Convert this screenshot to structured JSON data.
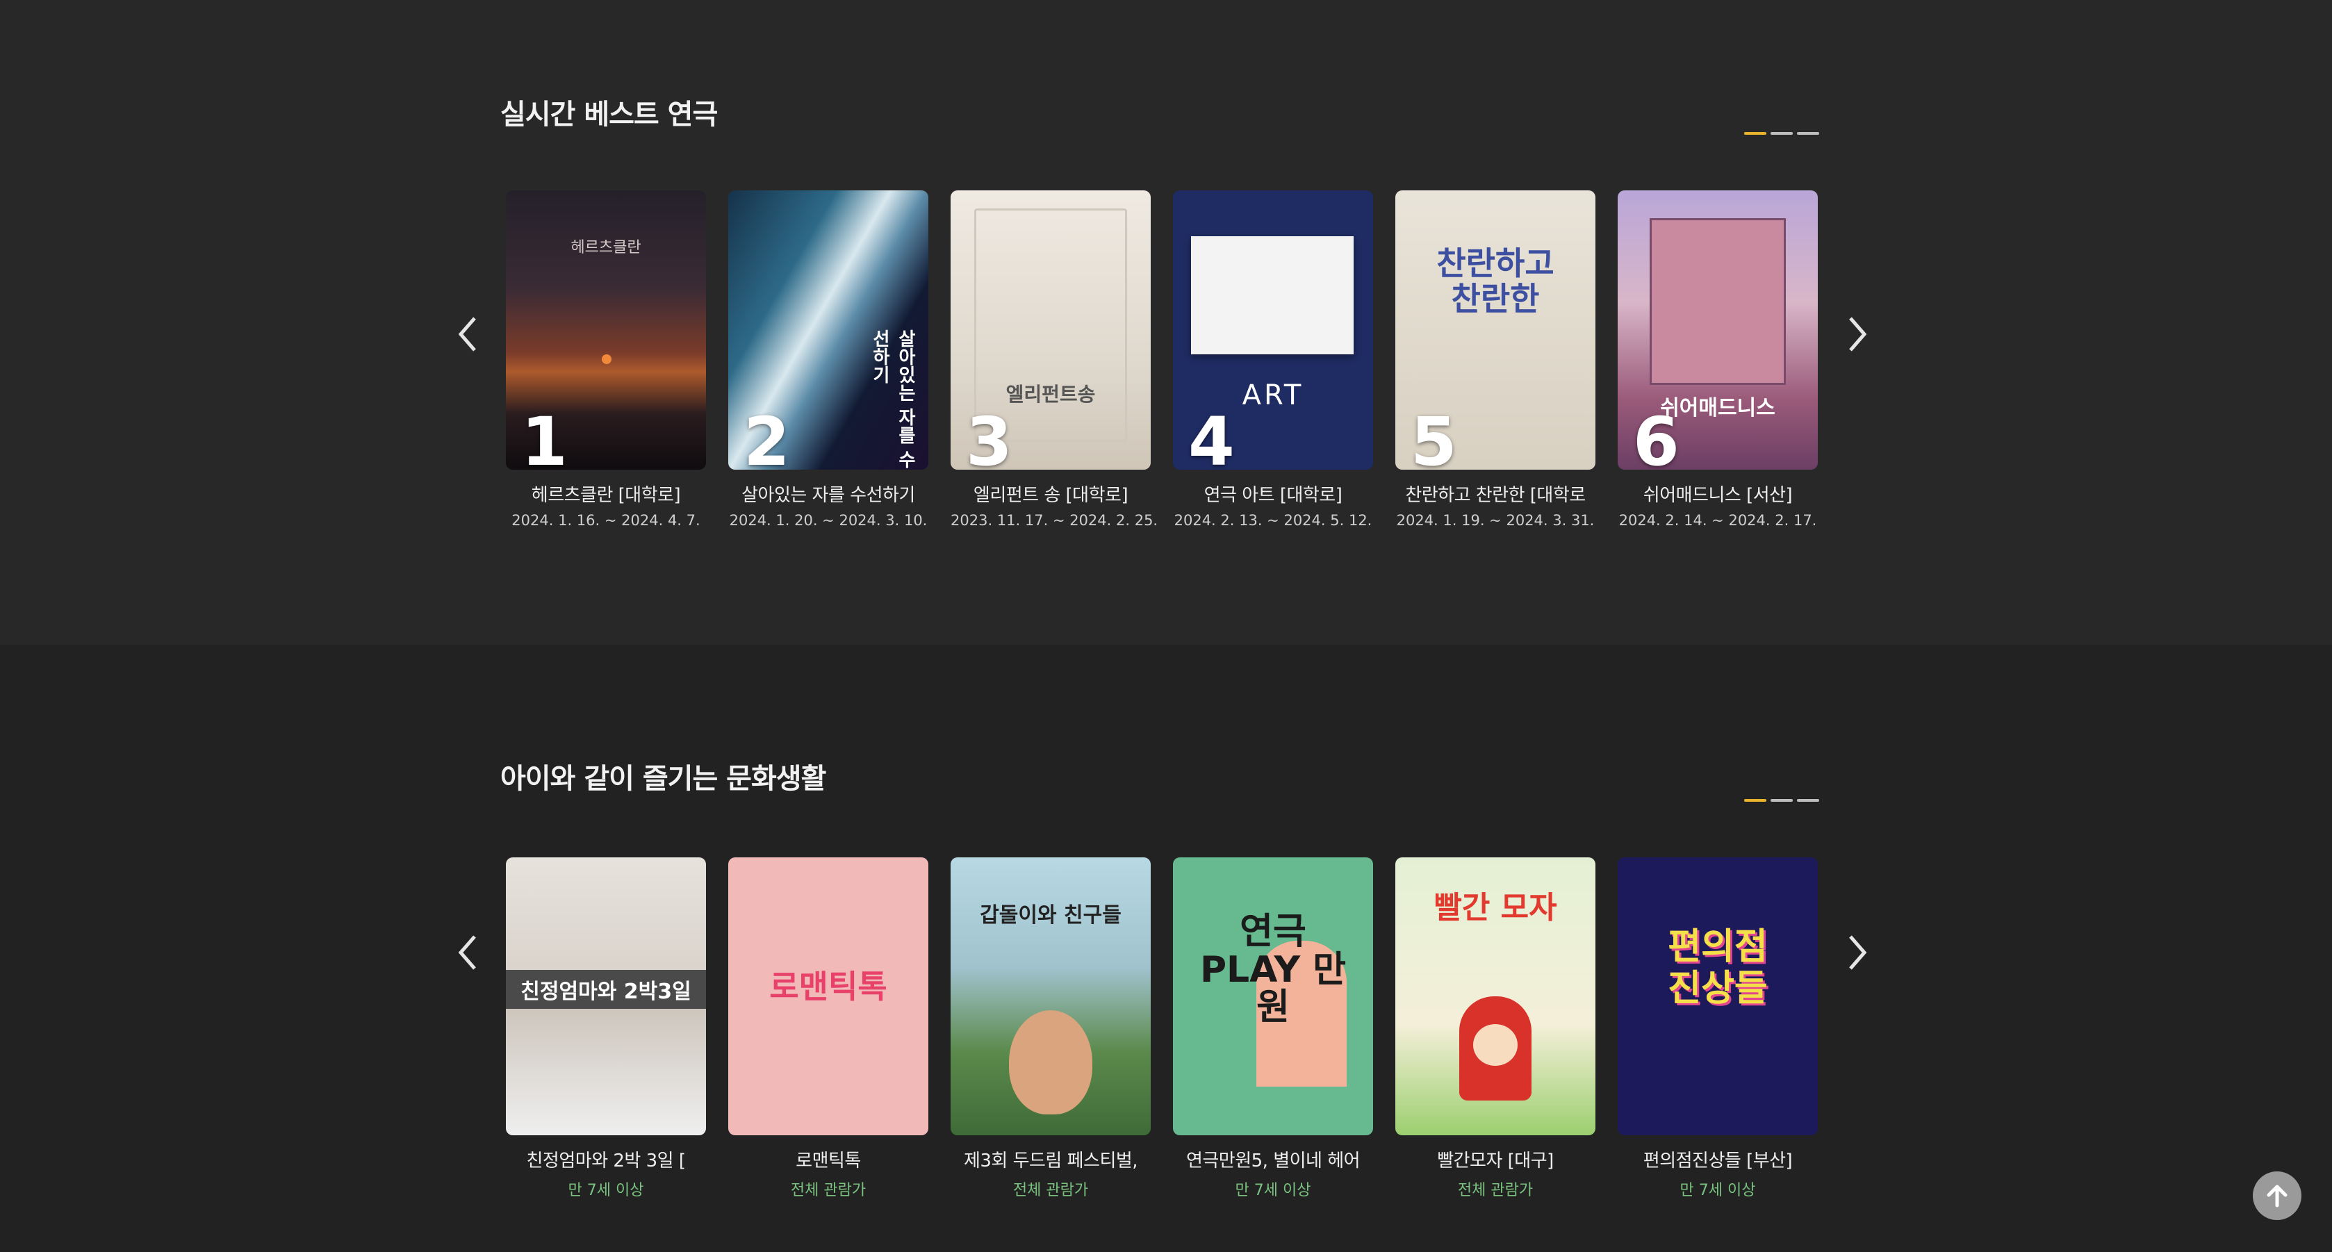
{
  "colors": {
    "page_bg": "#262626",
    "pager_active": "#e9b32c",
    "pager_inactive": "#bdbdbd",
    "age_text": "#79c27f"
  },
  "best": {
    "title": "실시간 베스트 연극",
    "items": [
      {
        "rank": "1",
        "name": "헤르츠클란 [대학로]",
        "date": "2024. 1. 16. ~ 2024. 4. 7.",
        "poster_text": "헤르츠클란"
      },
      {
        "rank": "2",
        "name": "살아있는 자를 수선하기",
        "date": "2024. 1. 20. ~ 2024. 3. 10.",
        "poster_text": "살아있는 자를 수선하기"
      },
      {
        "rank": "3",
        "name": "엘리펀트 송 [대학로]",
        "date": "2023. 11. 17. ~ 2024. 2. 25.",
        "poster_text": "엘리펀트송"
      },
      {
        "rank": "4",
        "name": "연극 아트 [대학로]",
        "date": "2024. 2. 13. ~ 2024. 5. 12.",
        "poster_text": "ART"
      },
      {
        "rank": "5",
        "name": "찬란하고 찬란한 [대학로",
        "date": "2024. 1. 19. ~ 2024. 3. 31.",
        "poster_text": "찬란하고 찬란한"
      },
      {
        "rank": "6",
        "name": "쉬어매드니스 [서산]",
        "date": "2024. 2. 14. ~ 2024. 2. 17.",
        "poster_text": "쉬어매드니스"
      }
    ]
  },
  "kids": {
    "title": "아이와 같이 즐기는 문화생활",
    "items": [
      {
        "name": "친정엄마와 2박 3일 [",
        "age": "만 7세 이상",
        "poster_text": "친정엄마와 2박3일"
      },
      {
        "name": "로맨틱톡",
        "age": "전체 관람가",
        "poster_text": "로맨틱톡"
      },
      {
        "name": "제3회 두드림 페스티벌,",
        "age": "전체 관람가",
        "poster_text": "갑돌이와 친구들"
      },
      {
        "name": "연극만원5, 별이네 헤어",
        "age": "만 7세 이상",
        "poster_text": "연극 PLAY 만원"
      },
      {
        "name": "빨간모자 [대구]",
        "age": "전체 관람가",
        "poster_text": "빨간 모자"
      },
      {
        "name": "편의점진상들 [부산]",
        "age": "만 7세 이상",
        "poster_text": "편의점 진상들"
      }
    ]
  }
}
